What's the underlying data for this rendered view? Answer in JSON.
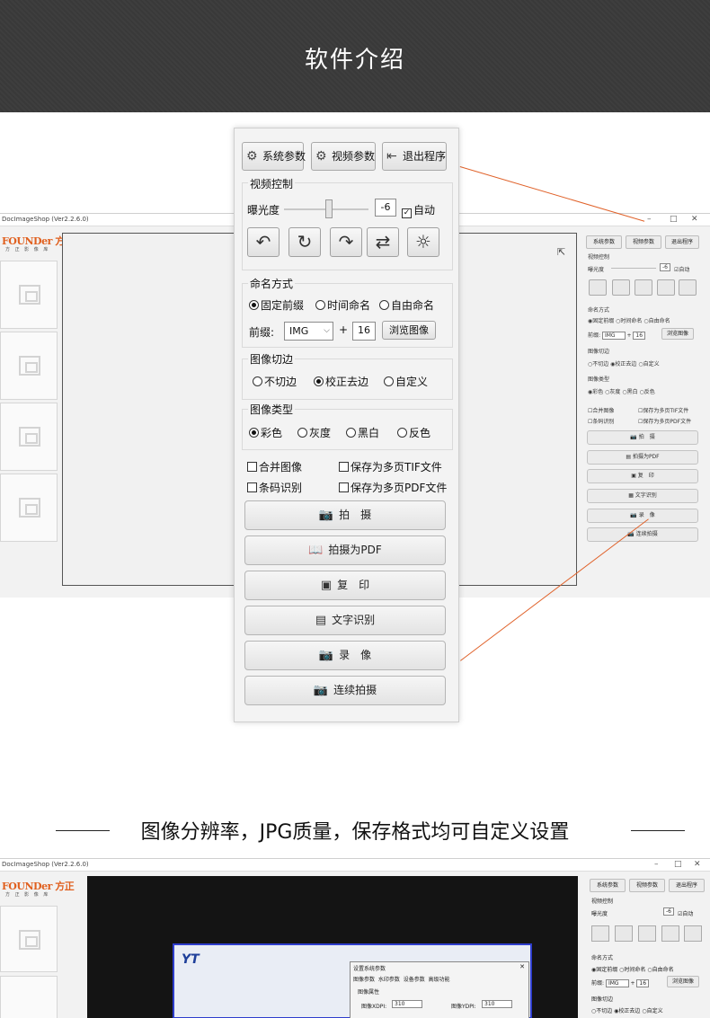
{
  "banner": {
    "title": "软件介绍"
  },
  "background_app": {
    "window_title": "DocImageShop (Ver2.2.6.0)",
    "logo_text": "FOUNDer 方正",
    "logo_sub": "方 正 影 像 库",
    "window_controls": [
      "–",
      "□",
      "✕"
    ]
  },
  "panel": {
    "buttons": {
      "system_params": "系统参数",
      "video_params": "视频参数",
      "exit": "退出程序"
    },
    "video_control": {
      "title": "视频控制",
      "exposure_label": "曝光度",
      "exposure_value": "-6",
      "auto_label": "自动",
      "auto_checked": true,
      "exposure_level_percent": 53
    },
    "icon_buttons": [
      "rotate-left-icon",
      "rotate-icon",
      "rotate-right-icon",
      "swap-icon",
      "brightness-icon"
    ],
    "naming": {
      "title": "命名方式",
      "options": [
        "固定前缀",
        "时间命名",
        "自由命名"
      ],
      "selected": 0,
      "prefix_label": "前缀:",
      "prefix_value": "IMG",
      "plus": "+",
      "number_value": "16",
      "browse_label": "浏览图像"
    },
    "crop": {
      "title": "图像切边",
      "options": [
        "不切边",
        "校正去边",
        "自定义"
      ],
      "selected": 1
    },
    "image_type": {
      "title": "图像类型",
      "options": [
        "彩色",
        "灰度",
        "黑白",
        "反色"
      ],
      "selected": 0
    },
    "checks": {
      "merge_images": "合并图像",
      "save_multipage_tif": "保存为多页TIF文件",
      "barcode": "条码识别",
      "save_multipage_pdf": "保存为多页PDF文件"
    },
    "actions": {
      "capture": "拍　摄",
      "capture_pdf": "拍摄为PDF",
      "copy": "复　印",
      "ocr": "文字识别",
      "record": "录　像",
      "continuous": "连续拍摄"
    }
  },
  "subtitle": "图像分辨率，JPG质量，保存格式均可自定义设置",
  "second_screenshot": {
    "window_title": "DocImageShop (Ver2.2.6.0)",
    "dialog_title": "设置系统参数",
    "dialog_tabs": [
      "图像参数",
      "水印参数",
      "设备参数",
      "高级功能"
    ],
    "dialog_group": "图像属性",
    "xdpi_label": "图像XDPI:",
    "xdpi_value": "310",
    "ydpi_label": "图像YDPI:",
    "ydpi_value": "310",
    "mini_labels": [
      "视频控制",
      "曝光度",
      "命名方式",
      "图像切边"
    ],
    "mini_naming": [
      "固定前缀",
      "时间命名",
      "自由命名"
    ],
    "mini_prefix_label": "前缀:",
    "mini_prefix": "IMG",
    "mini_number": "16",
    "mini_browse": "浏览图像",
    "mini_crop": [
      "不切边",
      "校正去边",
      "自定义"
    ],
    "mini_exposure_value": "-6",
    "mini_auto": "自动"
  },
  "colors": {
    "accent_line": "#e0622a",
    "banner_bg": "#3c3c3c",
    "selection_box": "#2e3dcc"
  }
}
